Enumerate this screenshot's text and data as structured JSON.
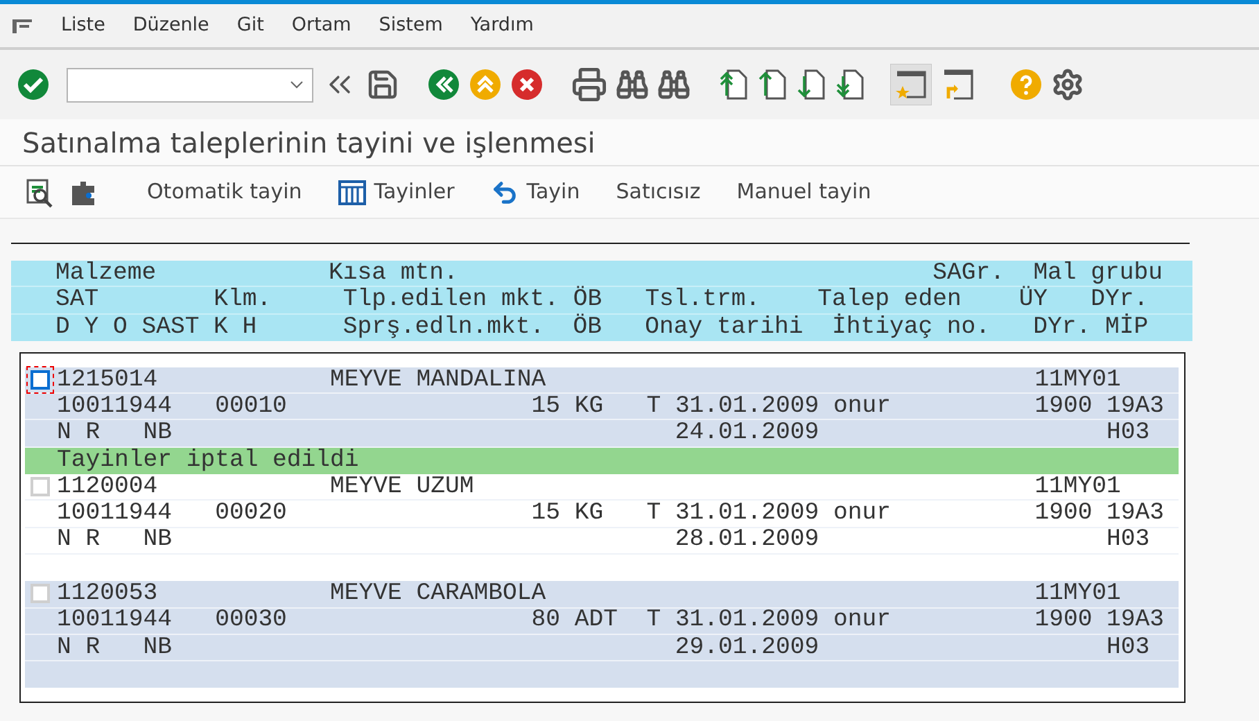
{
  "menu": [
    "Liste",
    "Düzenle",
    "Git",
    "Ortam",
    "Sistem",
    "Yardım"
  ],
  "screen_title": "Satınalma taleplerinin tayini ve işlenmesi",
  "app_toolbar": [
    {
      "kind": "icon"
    },
    {
      "kind": "icon"
    },
    {
      "kind": "button",
      "label": "Otomatik tayin"
    },
    {
      "kind": "button",
      "label": "Tayinler"
    },
    {
      "kind": "button",
      "label": "Tayin"
    },
    {
      "kind": "button",
      "label": "Satıcısız"
    },
    {
      "kind": "button",
      "label": "Manuel tayin"
    }
  ],
  "list_header": [
    [
      "Malzeme",
      "Kısa mtn.",
      "SAGr.",
      "Mal grubu"
    ],
    [
      "SAT",
      "Klm.",
      "Tlp.edilen mkt.",
      "ÖB",
      "Tsl.trm.",
      "Talep eden",
      "ÜY",
      "DYr."
    ],
    [
      "D",
      "Y",
      "O",
      "SAST",
      "K",
      "H",
      "Sprş.edln.mkt.",
      "ÖB",
      "Onay tarihi",
      "İhtiyaç no.",
      "DYr.",
      "MİP"
    ]
  ],
  "items": [
    {
      "focused": true,
      "lines": [
        [
          "1215014",
          "MEYVE MANDALINA",
          "11MY01"
        ],
        [
          "10011944",
          "00010",
          "15",
          "KG",
          "T",
          "31.01.2009",
          "onur",
          "1900",
          "19A3"
        ],
        [
          "N",
          "R",
          "NB",
          "24.01.2009",
          "H03"
        ]
      ],
      "message": "Tayinler iptal edildi"
    },
    {
      "focused": false,
      "lines": [
        [
          "1120004",
          "MEYVE UZUM",
          "11MY01"
        ],
        [
          "10011944",
          "00020",
          "15",
          "KG",
          "T",
          "31.01.2009",
          "onur",
          "1900",
          "19A3"
        ],
        [
          "N",
          "R",
          "NB",
          "28.01.2009",
          "H03"
        ]
      ]
    },
    {
      "focused": false,
      "lines": [
        [
          "1120053",
          "MEYVE CARAMBOLA",
          "11MY01"
        ],
        [
          "10011944",
          "00030",
          "80",
          "ADT",
          "T",
          "31.01.2009",
          "onur",
          "1900",
          "19A3"
        ],
        [
          "N",
          "R",
          "NB",
          "29.01.2009",
          "H03"
        ]
      ]
    }
  ]
}
